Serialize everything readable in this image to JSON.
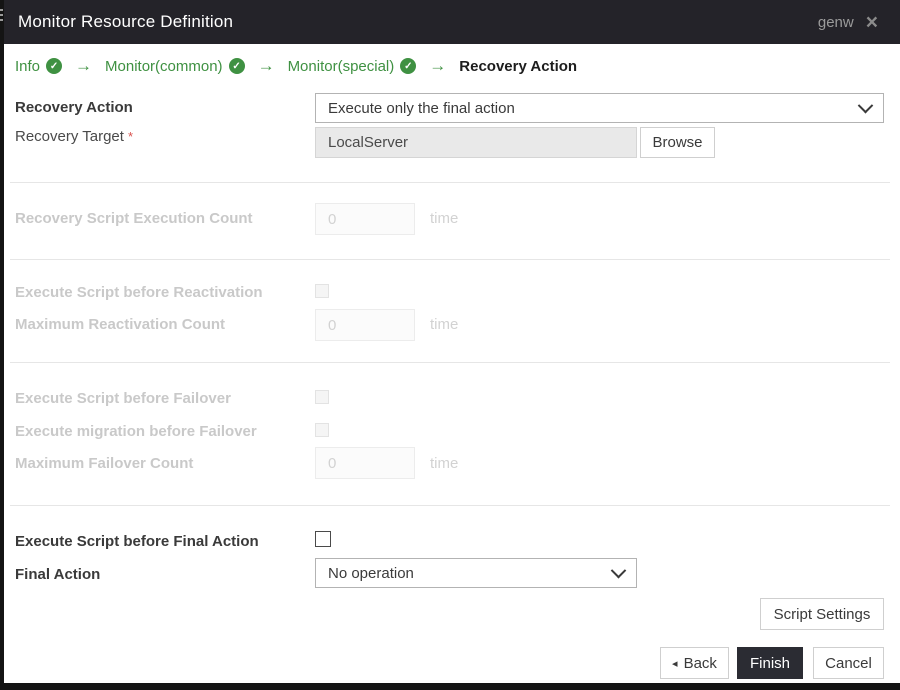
{
  "dialog": {
    "title": "Monitor Resource Definition",
    "window_badge": "genw"
  },
  "icons": {
    "close": "×",
    "check": "✓",
    "arrow": "→",
    "back_triangle": "◂"
  },
  "wizard": {
    "steps": [
      {
        "label": "Info",
        "done": true
      },
      {
        "label": "Monitor(common)",
        "done": true
      },
      {
        "label": "Monitor(special)",
        "done": true
      },
      {
        "label": "Recovery Action",
        "done": false,
        "current": true
      }
    ]
  },
  "form": {
    "recovery_action": {
      "label": "Recovery Action",
      "value": "Execute only the final action"
    },
    "recovery_target": {
      "label": "Recovery Target",
      "required_mark": "*",
      "value": "LocalServer",
      "browse_label": "Browse"
    },
    "recovery_script_execution_count": {
      "label": "Recovery Script Execution Count",
      "value": "0",
      "unit": "time",
      "disabled": true
    },
    "execute_script_before_reactivation": {
      "label": "Execute Script before Reactivation",
      "checked": false,
      "disabled": true
    },
    "maximum_reactivation_count": {
      "label": "Maximum Reactivation Count",
      "value": "0",
      "unit": "time",
      "disabled": true
    },
    "execute_script_before_failover": {
      "label": "Execute Script before Failover",
      "checked": false,
      "disabled": true
    },
    "execute_migration_before_failover": {
      "label": "Execute migration before Failover",
      "checked": false,
      "disabled": true
    },
    "maximum_failover_count": {
      "label": "Maximum Failover Count",
      "value": "0",
      "unit": "time",
      "disabled": true
    },
    "execute_script_before_final_action": {
      "label": "Execute Script before Final Action",
      "checked": false
    },
    "final_action": {
      "label": "Final Action",
      "value": "No operation"
    }
  },
  "buttons": {
    "script_settings": "Script Settings",
    "back": "Back",
    "finish": "Finish",
    "cancel": "Cancel"
  },
  "colors": {
    "accent_green": "#3f9142",
    "titlebar": "#242329",
    "finish_button": "#2b2c33",
    "required_red": "#d9534f"
  }
}
